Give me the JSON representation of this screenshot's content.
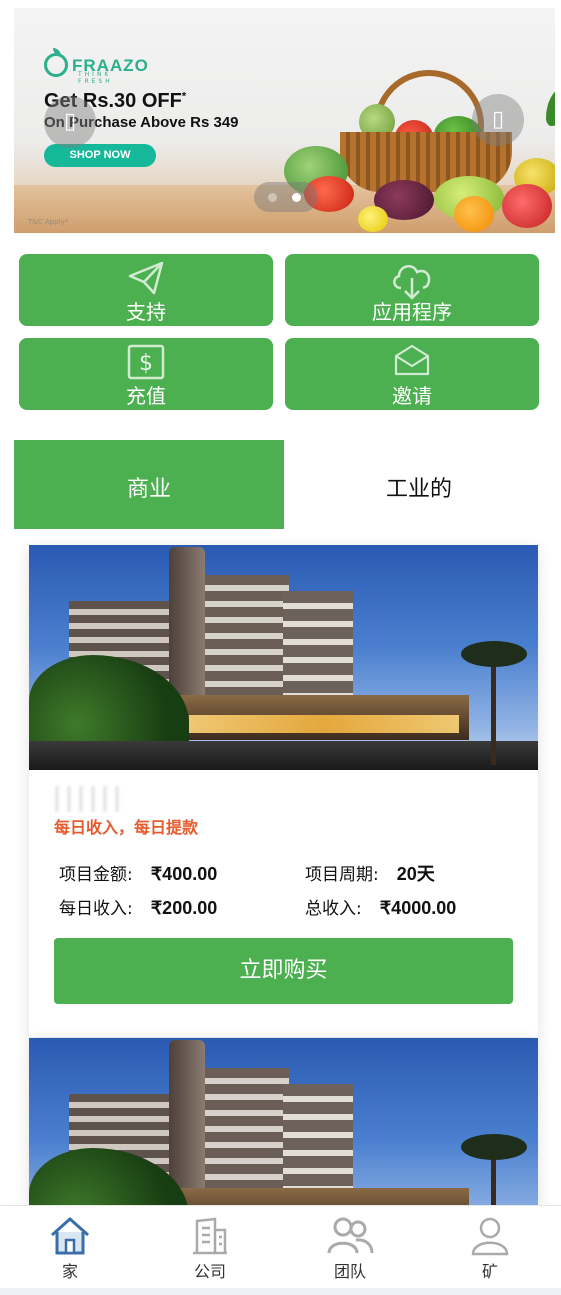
{
  "banner": {
    "brand": "FRAAZO",
    "brand_sub": "THINK FRESH",
    "title": "Get Rs.30 OFF",
    "title_mark": "*",
    "subtitle": "On Purchase Above Rs 349",
    "shop_label": "SHOP NOW",
    "tc": "T&C Apply*",
    "prev_glyph": "▯",
    "next_glyph": "▯",
    "slide_count": 2,
    "active_slide": 2
  },
  "actions": [
    {
      "label": "支持",
      "icon": "paper-plane-icon"
    },
    {
      "label": "应用程序",
      "icon": "cloud-download-icon"
    },
    {
      "label": "充值",
      "icon": "dollar-icon"
    },
    {
      "label": "邀请",
      "icon": "envelope-icon"
    }
  ],
  "tabs": [
    {
      "label": "商业",
      "active": true
    },
    {
      "label": "工业的",
      "active": false
    }
  ],
  "product": {
    "tag": "每日收入，每日提款",
    "amount_label": "项目金额:",
    "amount_value": "₹400.00",
    "period_label": "项目周期:",
    "period_value": "20天",
    "daily_label": "每日收入:",
    "daily_value": "₹200.00",
    "total_label": "总收入:",
    "total_value": "₹4000.00",
    "buy_label": "立即购买"
  },
  "bottom_nav": [
    {
      "label": "家",
      "icon": "home-icon",
      "active": true
    },
    {
      "label": "公司",
      "icon": "building-icon",
      "active": false
    },
    {
      "label": "团队",
      "icon": "team-icon",
      "active": false
    },
    {
      "label": "矿",
      "icon": "user-icon",
      "active": false
    }
  ],
  "colors": {
    "accent": "#4caf50",
    "brand": "#2bb08b",
    "tag": "#e65c2e",
    "nav_active": "#3a6ea8"
  }
}
